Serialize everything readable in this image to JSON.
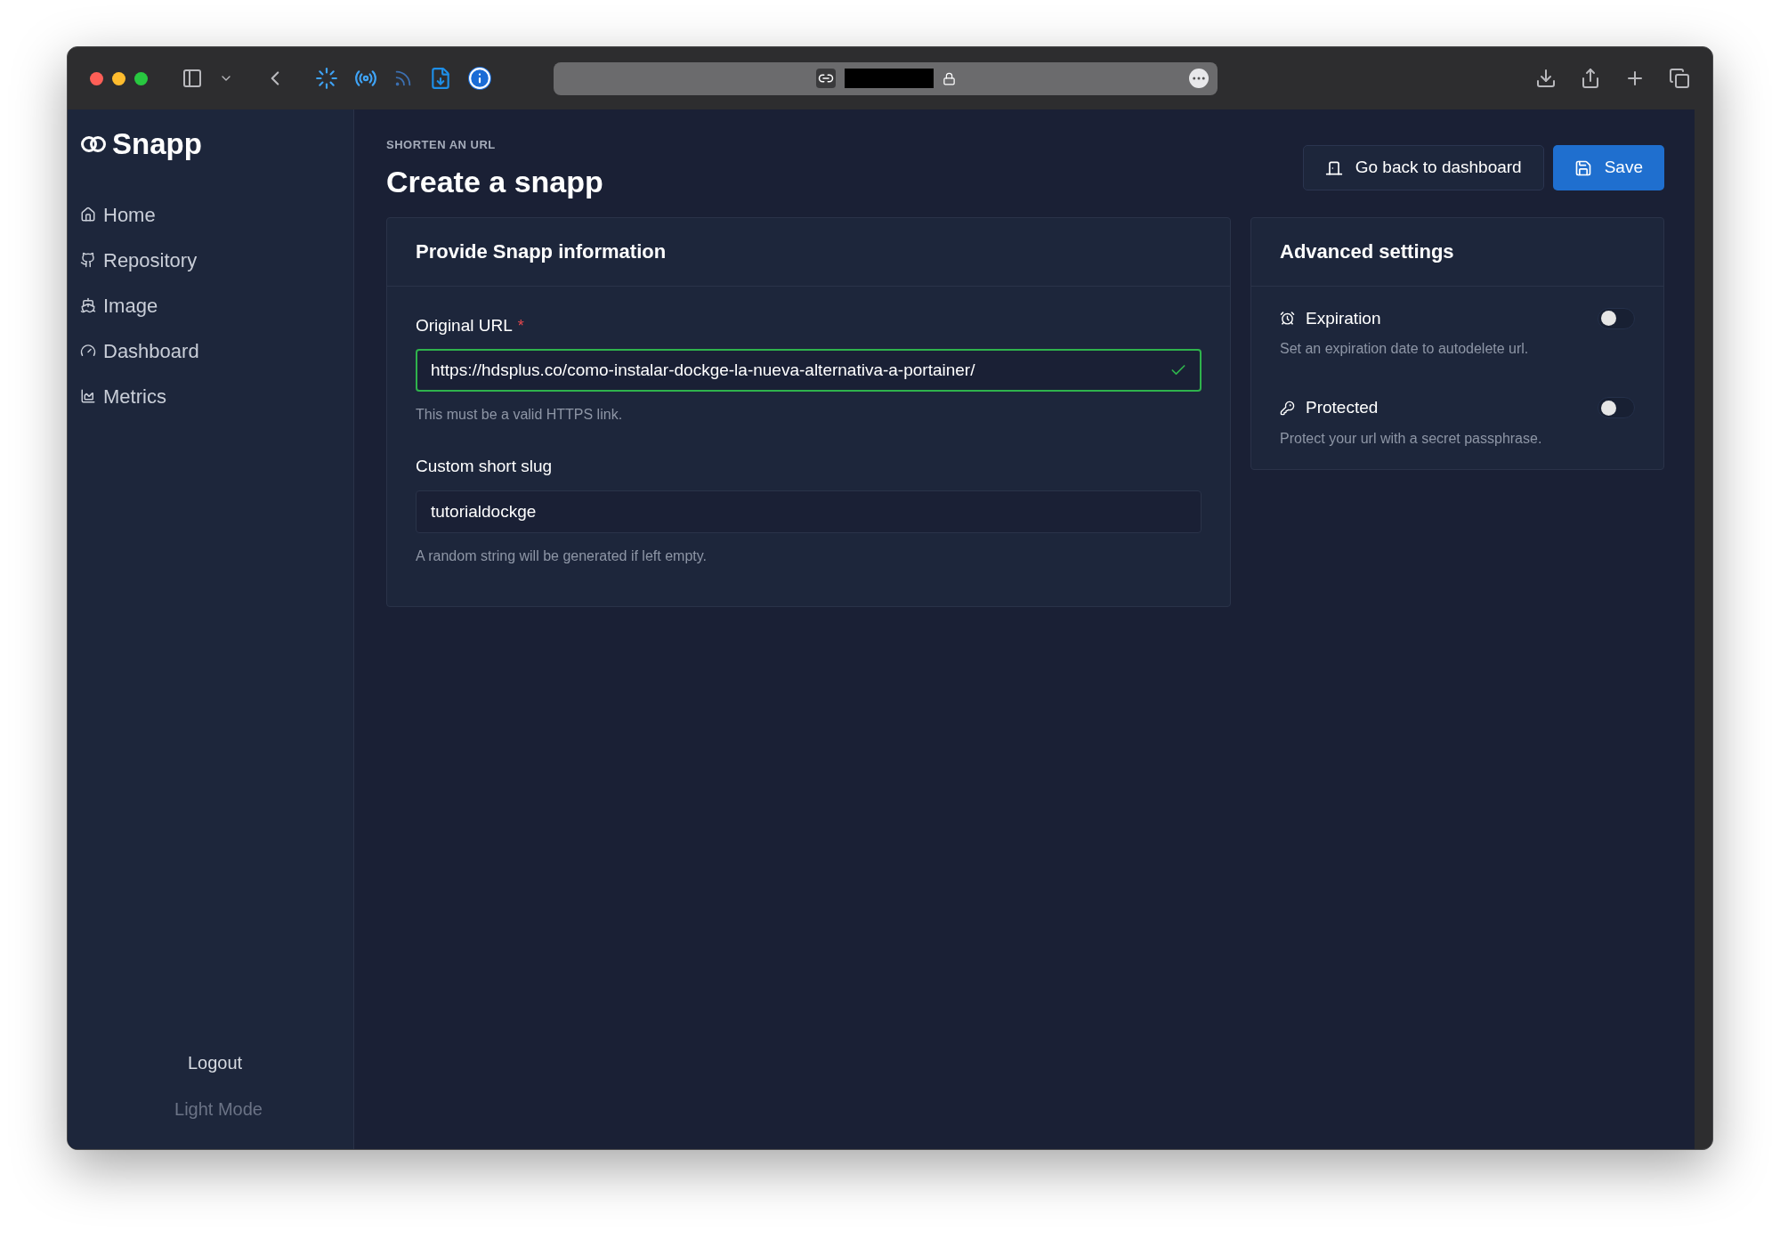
{
  "sidebar": {
    "brand": "Snapp",
    "items": [
      {
        "label": "Home"
      },
      {
        "label": "Repository"
      },
      {
        "label": "Image"
      },
      {
        "label": "Dashboard"
      },
      {
        "label": "Metrics"
      }
    ],
    "logout": "Logout",
    "theme_toggle": "Light Mode"
  },
  "header": {
    "eyebrow": "SHORTEN AN URL",
    "title": "Create a snapp",
    "buttons": [
      {
        "label": "Go back to dashboard",
        "kind": "secondary"
      },
      {
        "label": "Save",
        "kind": "primary"
      }
    ]
  },
  "form": {
    "title": "Provide Snapp information",
    "fields": [
      {
        "label": "Original URL",
        "required_mark": "*",
        "value": "https://hdsplus.co/como-instalar-dockge-la-nueva-alternativa-a-portainer/",
        "valid": true,
        "hint": "This must be a valid HTTPS link."
      },
      {
        "label": "Custom short slug",
        "value": "tutorialdockge",
        "valid": false,
        "hint": "A random string will be generated if left empty."
      }
    ]
  },
  "advanced": {
    "title": "Advanced settings",
    "settings": [
      {
        "label": "Expiration",
        "description": "Set an expiration date to autodelete url.",
        "on": false
      },
      {
        "label": "Protected",
        "description": "Protect your url with a secret passphrase.",
        "on": false
      }
    ]
  }
}
